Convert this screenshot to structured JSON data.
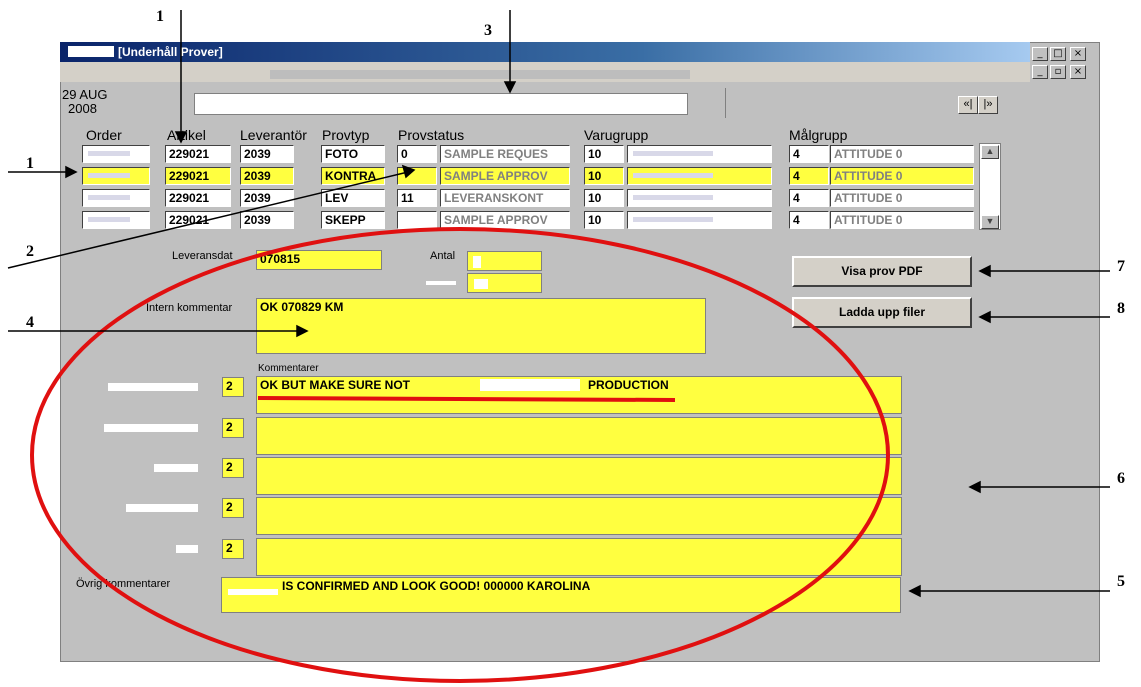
{
  "window": {
    "title": "[Underhåll Prover]",
    "controls": {
      "minimize": "_",
      "maximize": "□",
      "close": "×",
      "restore": "▫"
    }
  },
  "header": {
    "date_line1": "29 AUG",
    "date_line2": "2008",
    "nav_prev": "«|",
    "nav_next": "|»"
  },
  "table": {
    "columns": [
      "Order",
      "Artikel",
      "Leverantör",
      "Provtyp",
      "Provstatus",
      "Varugrupp",
      "Målgrupp"
    ],
    "rows": [
      {
        "artikel": "229021",
        "leverantor": "2039",
        "provtyp": "FOTO",
        "status_code": "0",
        "status_text": "SAMPLE REQUES",
        "varugrupp": "10",
        "malgrupp_code": "4",
        "malgrupp_text": "ATTITUDE 0"
      },
      {
        "artikel": "229021",
        "leverantor": "2039",
        "provtyp": "KONTRA",
        "status_code": "",
        "status_text": "SAMPLE APPROV",
        "varugrupp": "10",
        "malgrupp_code": "4",
        "malgrupp_text": "ATTITUDE 0"
      },
      {
        "artikel": "229021",
        "leverantor": "2039",
        "provtyp": "LEV",
        "status_code": "11",
        "status_text": "LEVERANSKONT",
        "varugrupp": "10",
        "malgrupp_code": "4",
        "malgrupp_text": "ATTITUDE 0"
      },
      {
        "artikel": "229021",
        "leverantor": "2039",
        "provtyp": "SKEPP",
        "status_code": "",
        "status_text": "SAMPLE APPROV",
        "varugrupp": "10",
        "malgrupp_code": "4",
        "malgrupp_text": "ATTITUDE 0"
      }
    ]
  },
  "form": {
    "leveransdatum_label": "Leveransdat",
    "leveransdatum_value": "070815",
    "antal_label": "Antal",
    "intern_label": "Intern kommentar",
    "intern_value": "OK 070829 KM",
    "kommentarer_label": "Kommentarer",
    "comment_codes": [
      "2",
      "2",
      "2",
      "2",
      "2"
    ],
    "comment_1_part1": "OK BUT MAKE SURE NOT",
    "comment_1_part2": "PRODUCTION",
    "ovrig_label": "Övrig kommentarer",
    "ovrig_value": "IS CONFIRMED AND LOOK GOOD! 000000 KAROLINA"
  },
  "buttons": {
    "visa_pdf": "Visa prov PDF",
    "ladda_upp": "Ladda upp filer"
  },
  "annotations": {
    "n1a": "1",
    "n1b": "1",
    "n2": "2",
    "n3": "3",
    "n4": "4",
    "n5": "5",
    "n6": "6",
    "n7": "7",
    "n8": "8"
  },
  "colors": {
    "field_yellow": "#ffff40",
    "annotation_red": "#e01010",
    "window_grey": "#c0c0c0"
  }
}
